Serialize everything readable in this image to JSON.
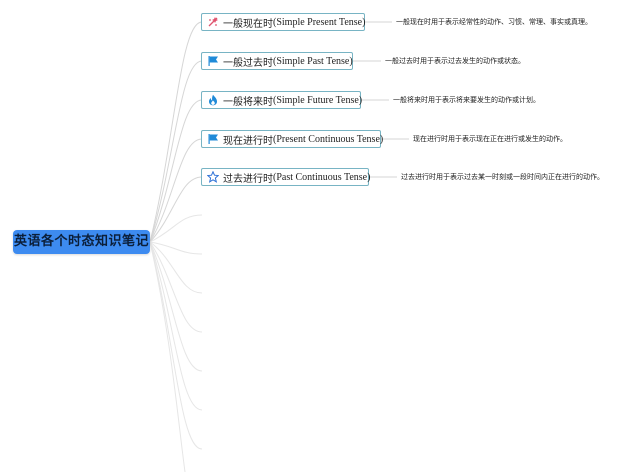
{
  "root": {
    "label": "英语各个时态知识笔记"
  },
  "branches": [
    {
      "icon": "sparkle-icon",
      "title": "一般现在时",
      "english": " (Simple Present Tense)",
      "desc": "一般现在时用于表示经常性的动作、习惯、常理、事实或真理。"
    },
    {
      "icon": "flag-icon",
      "title": "一般过去时",
      "english": " (Simple Past Tense)",
      "desc": "一般过去时用于表示过去发生的动作或状态。"
    },
    {
      "icon": "fire-icon",
      "title": "一般将来时",
      "english": " (Simple Future Tense)",
      "desc": "一般将来时用于表示将来要发生的动作或计划。"
    },
    {
      "icon": "flag-icon",
      "title": "现在进行时",
      "english": " (Present Continuous Tense)",
      "desc": "现在进行时用于表示现在正在进行或发生的动作。"
    },
    {
      "icon": "star-outline-icon",
      "title": "过去进行时",
      "english": " (Past Continuous Tense)",
      "desc": "过去进行时用于表示过去某一时刻或一段时间内正在进行的动作。"
    }
  ],
  "colors": {
    "root_bg": "#3d8bf0",
    "node_border": "#78b4c4",
    "connector": "#d6d6d6",
    "sparkle": "#e0536e",
    "flag": "#1f8ad8",
    "fire": "#1f8ad8",
    "star": "#2b6fd6"
  }
}
